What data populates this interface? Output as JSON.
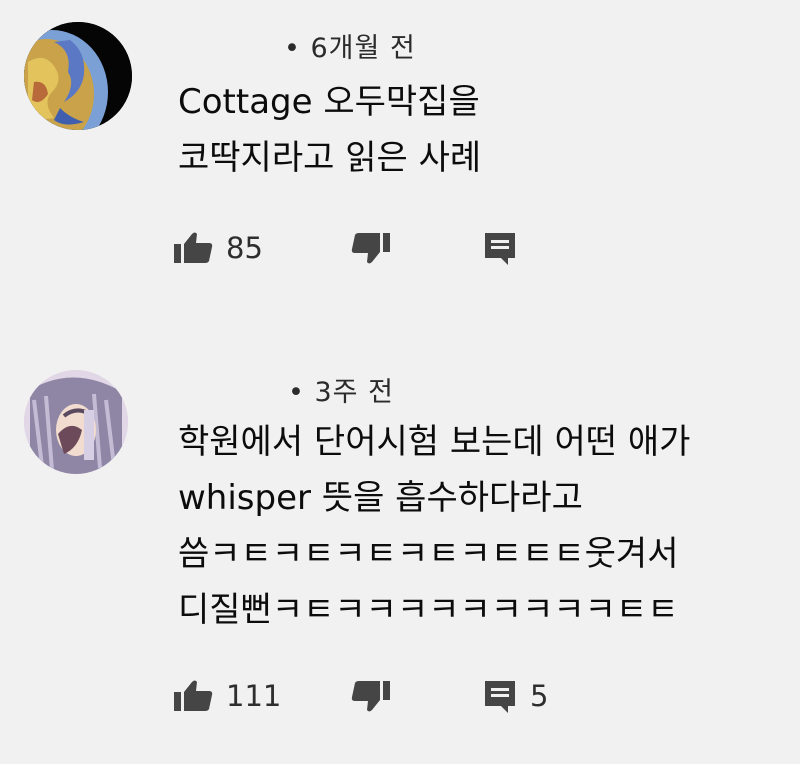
{
  "colors": {
    "background": "#f1f1f1",
    "text": "#0c0c0c",
    "icon": "#454545"
  },
  "comments": [
    {
      "avatar_icon": "globe-avatar-icon",
      "meta": "• 6개월 전",
      "lines": [
        "Cottage 오두막집을",
        "코딱지라고 읽은 사례"
      ],
      "likes": "85",
      "reply_count": ""
    },
    {
      "avatar_icon": "anime-avatar-icon",
      "meta": "• 3주 전",
      "lines": [
        "학원에서 단어시험 보는데 어떤 애가",
        "whisper 뜻을 흡수하다라고",
        "씀ㅋㅌㅋㅌㅋㅌㅋㅌㅋㅌㅌㅌ웃겨서",
        "디질뻔ㅋㅌㅋㅋㅋㅋㅋㅋㅋㅋㅋㅌㅌ"
      ],
      "likes": "111",
      "reply_count": "5"
    }
  ]
}
